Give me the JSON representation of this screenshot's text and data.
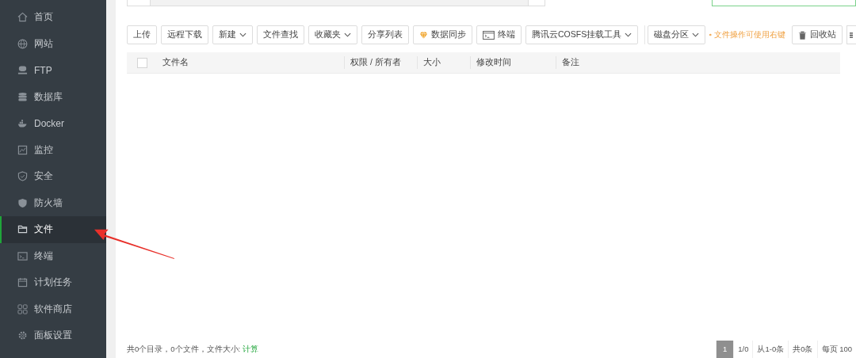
{
  "sidebar": {
    "items": [
      {
        "label": "首页",
        "selected": false
      },
      {
        "label": "网站",
        "selected": false
      },
      {
        "label": "FTP",
        "selected": false
      },
      {
        "label": "数据库",
        "selected": false
      },
      {
        "label": "Docker",
        "selected": false
      },
      {
        "label": "监控",
        "selected": false
      },
      {
        "label": "安全",
        "selected": false
      },
      {
        "label": "防火墙",
        "selected": false
      },
      {
        "label": "文件",
        "selected": true
      },
      {
        "label": "终端",
        "selected": false
      },
      {
        "label": "计划任务",
        "selected": false
      },
      {
        "label": "软件商店",
        "selected": false
      },
      {
        "label": "面板设置",
        "selected": false
      }
    ]
  },
  "toolbar": {
    "buttons": [
      {
        "label": "上传",
        "kind": "plain"
      },
      {
        "label": "远程下载",
        "kind": "plain"
      },
      {
        "label": "新建",
        "kind": "menu"
      },
      {
        "label": "文件查找",
        "kind": "plain"
      },
      {
        "label": "收藏夹",
        "kind": "menu"
      },
      {
        "label": "分享列表",
        "kind": "plain"
      },
      {
        "label": "数据同步",
        "kind": "sync"
      },
      {
        "label": "终端",
        "kind": "terminal"
      },
      {
        "label": "腾讯云COSFS挂载工具",
        "kind": "menu"
      },
      {
        "label": "磁盘分区",
        "kind": "menu"
      }
    ],
    "hint": "文件操作可使用右键",
    "recycle_button": "回收站"
  },
  "table": {
    "select_all_checked": false,
    "columns": [
      "文件名",
      "权限 / 所有者",
      "大小",
      "修改时间",
      "备注"
    ]
  },
  "footer": {
    "summary": "共0个目录，0个文件，文件大小:",
    "calc_link": "计算",
    "pagination": [
      {
        "label": "1",
        "selected": true
      },
      {
        "label": "1/0",
        "selected": false
      },
      {
        "label": "从1-0条",
        "selected": false
      },
      {
        "label": "共0条",
        "selected": false
      },
      {
        "label": "每页 100",
        "selected": false
      }
    ]
  }
}
